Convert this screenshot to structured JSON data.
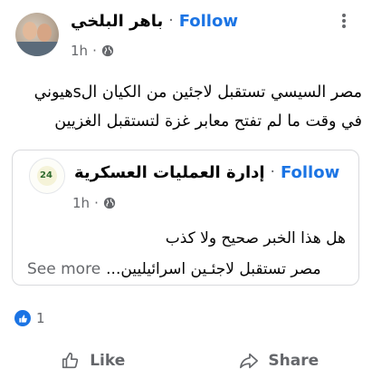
{
  "post": {
    "author": "باهر البلخي",
    "separator": "·",
    "follow": "Follow",
    "time": "1h",
    "text_line1": "مصر السيسي تستقبل لاجئين من الكيان الsهيوني",
    "text_line2": "في وقت ما لم تفتح معابر غزة لتستقبل الغزيين"
  },
  "shared": {
    "author": "إدارة العمليات العسكرية",
    "separator": "·",
    "follow": "Follow",
    "time": "1h",
    "logo_text": "24",
    "text_line1": "هل هذا الخبر صحيح ولا كذب",
    "text_line2": "مصر تستقبل لاجئـين اسرائيليين...",
    "see_more": "See more"
  },
  "reactions": {
    "count": "1"
  },
  "actions": {
    "like": "Like",
    "share": "Share"
  },
  "icons": {
    "more": "more-vertical-icon",
    "privacy": "globe-icon",
    "reaction": "like-reaction-icon",
    "like": "thumb-up-icon",
    "share": "share-arrow-icon"
  },
  "colors": {
    "accent": "#1b74e4",
    "secondary_text": "#65676b",
    "border": "#d9dadd"
  }
}
